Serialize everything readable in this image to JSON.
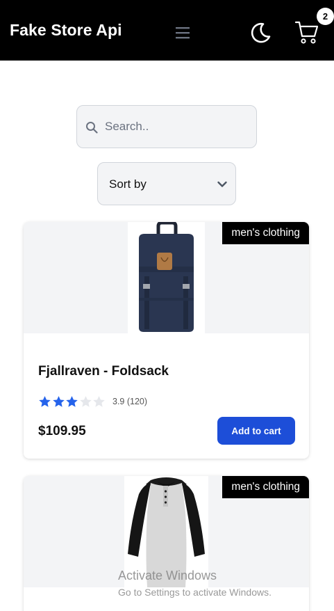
{
  "navbar": {
    "brand": "Fake Store Api",
    "menu_icon": "hamburger-menu-icon",
    "theme_icon": "moon-icon",
    "cart_icon": "shopping-cart-icon",
    "cart_count": "2"
  },
  "search": {
    "placeholder": "Search..",
    "value": "",
    "icon": "search-icon"
  },
  "sort": {
    "selected": "Sort by",
    "icon": "chevron-down-icon"
  },
  "products": [
    {
      "title": "Fjallraven - Foldsack",
      "category": "men's clothing",
      "rating_value": 3.9,
      "rating_text": "3.9 (120)",
      "price": "$109.95",
      "add_label": "Add to cart"
    },
    {
      "title": "",
      "category": "men's clothing"
    }
  ],
  "watermark": {
    "title": "Activate Windows",
    "subtitle": "Go to Settings to activate Windows."
  },
  "colors": {
    "navbar": "#000000",
    "primary": "#1d4ed8",
    "star_filled": "#2563eb",
    "star_empty": "#e5e7eb",
    "panel": "#f3f4f6"
  }
}
